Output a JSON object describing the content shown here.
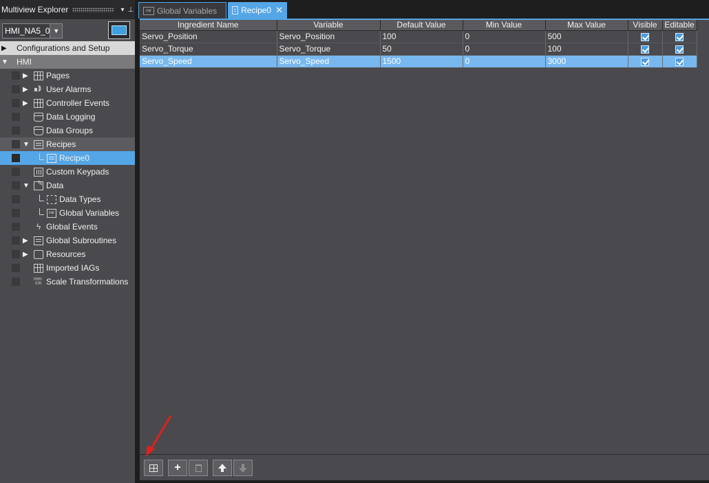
{
  "explorer": {
    "title": "Multiview Explorer",
    "pin_glyph": "▾",
    "pin2_glyph": "⊥",
    "device": "HMI_NA5_0",
    "sections": {
      "config": "Configurations and Setup",
      "hmi": "HMI"
    },
    "items": [
      {
        "label": "Pages",
        "icon": "pages-icon"
      },
      {
        "label": "User Alarms",
        "icon": "alarm-speaker-icon"
      },
      {
        "label": "Controller Events",
        "icon": "controller-events-icon"
      },
      {
        "label": "Data Logging",
        "icon": "data-logging-icon"
      },
      {
        "label": "Data Groups",
        "icon": "data-groups-icon"
      },
      {
        "label": "Recipes",
        "icon": "recipes-icon"
      },
      {
        "label": "Recipe0",
        "icon": "recipe-icon"
      },
      {
        "label": "Custom Keypads",
        "icon": "keypad-icon"
      },
      {
        "label": "Data",
        "icon": "data-icon"
      },
      {
        "label": "Data Types",
        "icon": "data-types-icon"
      },
      {
        "label": "Global Variables",
        "icon": "var-icon"
      },
      {
        "label": "Global Events",
        "icon": "bolt-icon"
      },
      {
        "label": "Global Subroutines",
        "icon": "subroutine-icon"
      },
      {
        "label": "Resources",
        "icon": "resources-icon"
      },
      {
        "label": "Imported IAGs",
        "icon": "iag-icon"
      },
      {
        "label": "Scale Transformations",
        "icon": "scale-icon"
      }
    ]
  },
  "tabs": [
    {
      "label": "Global Variables",
      "icon_text": "var",
      "active": false
    },
    {
      "label": "Recipe0",
      "active": true,
      "close": "✕"
    }
  ],
  "grid": {
    "columns": [
      "Ingredient Name",
      "Variable",
      "Default Value",
      "Min Value",
      "Max Value",
      "Visible",
      "Editable"
    ],
    "rows": [
      {
        "ingredient": "Servo_Position",
        "variable": "Servo_Position",
        "default": "100",
        "min": "0",
        "max": "500",
        "visible": true,
        "editable": true,
        "selected": false
      },
      {
        "ingredient": "Servo_Torque",
        "variable": "Servo_Torque",
        "default": "50",
        "min": "0",
        "max": "100",
        "visible": true,
        "editable": true,
        "selected": false
      },
      {
        "ingredient": "Servo_Speed",
        "variable": "Servo_Speed",
        "default": "1500",
        "min": "0",
        "max": "3000",
        "visible": true,
        "editable": true,
        "selected": true
      }
    ]
  },
  "toolbar": {
    "add_glyph": "+"
  },
  "colors": {
    "accent": "#55a6e6",
    "annotation_arrow": "#e0201c"
  }
}
